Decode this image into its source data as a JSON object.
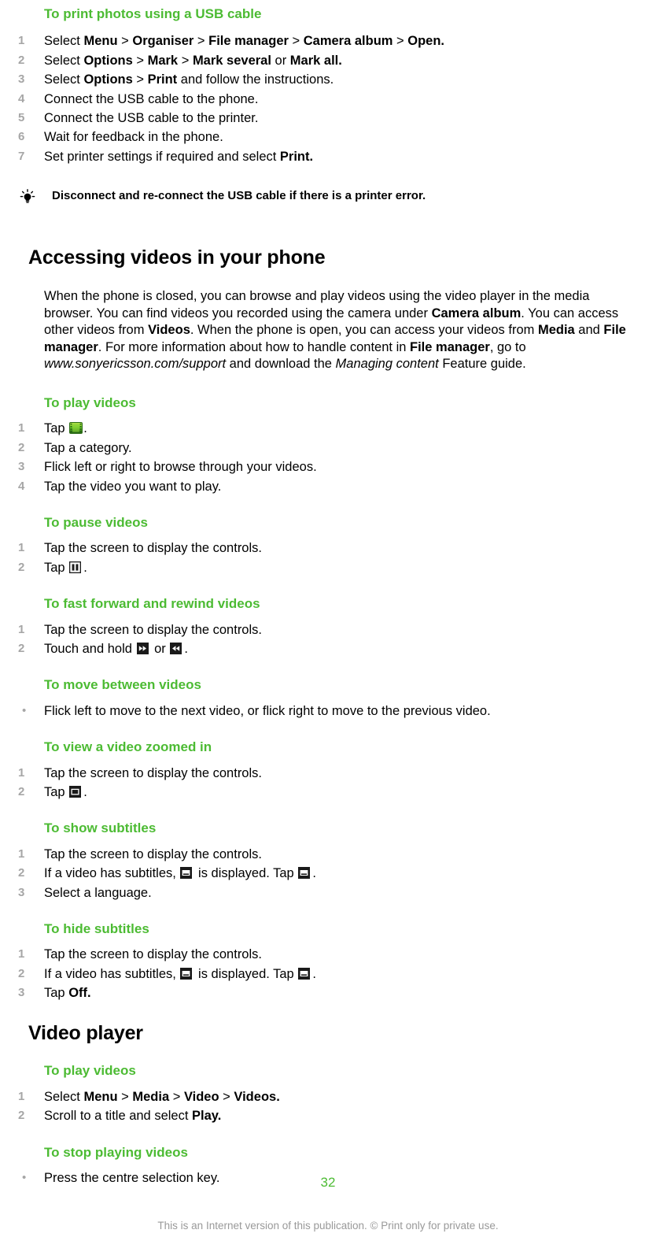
{
  "page": {
    "number": "32",
    "footer_note": "This is an Internet version of this publication. © Print only for private use.",
    "accent_green": "#4cbb33",
    "marker_gray": "#a6a6a6"
  },
  "print_section": {
    "heading": "To print photos using a USB cable",
    "steps": [
      {
        "lead": "Select ",
        "parts": [
          "Menu",
          " > ",
          "Organiser",
          " > ",
          "File manager",
          " > ",
          "Camera album",
          " > ",
          "Open",
          "."
        ]
      },
      {
        "lead": "Select ",
        "parts": [
          "Options",
          " > ",
          "Mark",
          " > ",
          "Mark several",
          " or ",
          "Mark all",
          "."
        ]
      },
      {
        "lead": "Select ",
        "parts": [
          "Options",
          " > ",
          "Print",
          " and follow the instructions."
        ]
      },
      {
        "lead": "Connect the USB cable to the phone.",
        "parts": []
      },
      {
        "lead": "Connect the USB cable to the printer.",
        "parts": []
      },
      {
        "lead": "Wait for feedback in the phone.",
        "parts": []
      },
      {
        "lead": "Set printer settings if required and select ",
        "parts": [
          "Print",
          "."
        ]
      }
    ],
    "step_1_select": "Select",
    "step_1_menu": "Menu",
    "step_1_organiser": "Organiser",
    "step_1_filemanager": "File manager",
    "step_1_cameraalbum": "Camera album",
    "step_1_open": "Open.",
    "step_2_select": "Select",
    "step_2_options": "Options",
    "step_2_mark": "Mark",
    "step_2_markseveral": "Mark several",
    "step_2_or": "or",
    "step_2_markall": "Mark all.",
    "step_3_select": "Select",
    "step_3_options": "Options",
    "step_3_print": "Print",
    "step_3_tail": "and follow the instructions.",
    "step_4": "Connect the USB cable to the phone.",
    "step_5": "Connect the USB cable to the printer.",
    "step_6": "Wait for feedback in the phone.",
    "step_7_lead": "Set printer settings if required and select",
    "step_7_print": "Print.",
    "tip": "Disconnect and re-connect the USB cable if there is a printer error."
  },
  "accessing_videos": {
    "heading": "Accessing videos in your phone",
    "body_1": "When the phone is closed, you can browse and play videos using the video player in the media browser. You can find videos you recorded using the camera under ",
    "bold_camera_album": "Camera album",
    "body_2": ". You can access other videos from ",
    "bold_videos": "Videos",
    "body_3": ". When the phone is open, you can access your videos from ",
    "bold_media": "Media",
    "body_4": " and ",
    "bold_file_manager": "File manager",
    "body_5": ". For more information about how to handle content in ",
    "bold_file_manager_2": "File manager",
    "body_6": ", go to ",
    "italic_url": "www.sonyericsson.com/support",
    "body_7": " and download the ",
    "italic_managing": "Managing content",
    "body_8": " Feature guide."
  },
  "play_videos": {
    "heading": "To play videos",
    "step_1_lead": "Tap",
    "step_1_icon": "video-filmstrip-icon",
    "step_1_tail": ".",
    "step_2": "Tap a category.",
    "step_3": "Flick left or right to browse through your videos.",
    "step_4": "Tap the video you want to play."
  },
  "pause_videos": {
    "heading": "To pause videos",
    "step_1": "Tap the screen to display the controls.",
    "step_2_lead": "Tap",
    "step_2_icon": "pause-icon",
    "step_2_tail": "."
  },
  "fast_forward": {
    "heading": "To fast forward and rewind videos",
    "step_1": "Tap the screen to display the controls.",
    "step_2_lead": "Touch and hold",
    "step_2_icon_a": "fast-forward-icon",
    "step_2_mid": "or",
    "step_2_icon_b": "rewind-icon",
    "step_2_tail": "."
  },
  "move_between": {
    "heading": "To move between videos",
    "bullet_1": "Flick left to move to the next video, or flick right to move to the previous video."
  },
  "zoomed_in": {
    "heading": "To view a video zoomed in",
    "step_1": "Tap the screen to display the controls.",
    "step_2_lead": "Tap",
    "step_2_icon": "zoom-frame-icon",
    "step_2_tail": "."
  },
  "show_subtitles": {
    "heading": "To show subtitles",
    "step_1": "Tap the screen to display the controls.",
    "step_2_lead": "If a video has subtitles,",
    "step_2_icon_a": "subtitle-icon",
    "step_2_mid": "is displayed. Tap",
    "step_2_icon_b": "subtitle-icon",
    "step_2_tail": ".",
    "step_3": "Select a language."
  },
  "hide_subtitles": {
    "heading": "To hide subtitles",
    "step_1": "Tap the screen to display the controls.",
    "step_2_lead": "If a video has subtitles,",
    "step_2_icon_a": "subtitle-icon",
    "step_2_mid": "is displayed. Tap",
    "step_2_icon_b": "subtitle-icon",
    "step_2_tail": ".",
    "step_3_lead": "Tap",
    "step_3_off": "Off."
  },
  "video_player": {
    "heading": "Video player",
    "play": {
      "heading": "To play videos",
      "step_1_lead": "Select",
      "step_1_menu": "Menu",
      "step_1_media": "Media",
      "step_1_video": "Video",
      "step_1_videos": "Videos.",
      "step_2_lead": "Scroll to a title and select",
      "step_2_play": "Play."
    },
    "stop": {
      "heading": "To stop playing videos",
      "bullet_1": "Press the centre selection key."
    }
  }
}
